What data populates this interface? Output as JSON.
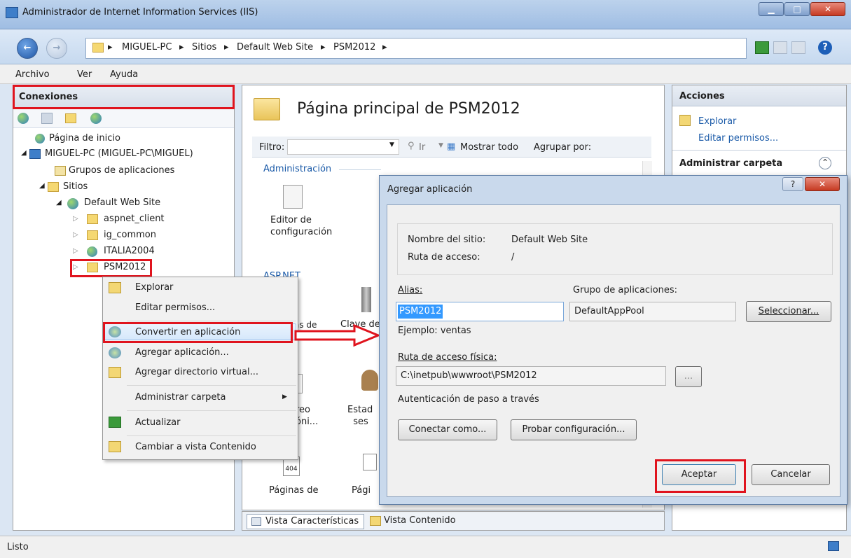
{
  "window": {
    "title": "Administrador de Internet Information Services (IIS)"
  },
  "breadcrumb": [
    "MIGUEL-PC",
    "Sitios",
    "Default Web Site",
    "PSM2012"
  ],
  "menu": [
    "Archivo",
    "Ver",
    "Ayuda"
  ],
  "connections": {
    "title": "Conexiones",
    "tree": [
      "Página de inicio",
      "MIGUEL-PC (MIGUEL-PC\\MIGUEL)",
      "Grupos de aplicaciones",
      "Sitios",
      "Default Web Site",
      "aspnet_client",
      "ig_common",
      "ITALIA2004",
      "PSM2012"
    ]
  },
  "context_menu": [
    "Explorar",
    "Editar permisos...",
    "Convertir en aplicación",
    "Agregar aplicación...",
    "Agregar directorio virtual...",
    "Administrar carpeta",
    "Actualizar",
    "Cambiar a vista Contenido"
  ],
  "center": {
    "title": "Página principal de PSM2012",
    "filter_label": "Filtro:",
    "go_label": "Ir",
    "show_all": "Mostrar todo",
    "group_by": "Agrupar por:",
    "section_admin": "Administración",
    "section_aspnet": "ASP.NET",
    "features": {
      "config_editor": "Editor de configuración",
      "conn_strings_partial": "...as de ...xión",
      "machine_key_partial": "Clave de",
      "smtp_partial": "...reo ...óni...",
      "session_partial": "Estad... ses...",
      "error_pages": "Páginas de",
      "pages_partial": "Pági..."
    },
    "tab_features": "Vista Características",
    "tab_content": "Vista Contenido"
  },
  "actions": {
    "title": "Acciones",
    "explore": "Explorar",
    "edit_permissions": "Editar permisos...",
    "manage_folder": "Administrar carpeta"
  },
  "dialog": {
    "title": "Agregar aplicación",
    "site_name_label": "Nombre del sitio:",
    "site_name_value": "Default Web Site",
    "path_label": "Ruta de acceso:",
    "path_value": "/",
    "alias_label": "Alias:",
    "alias_value": "PSM2012",
    "pool_label": "Grupo de aplicaciones:",
    "pool_value": "DefaultAppPool",
    "select_button": "Seleccionar...",
    "example": "Ejemplo: ventas",
    "physical_path_label": "Ruta de acceso física:",
    "physical_path_value": "C:\\inetpub\\wwwroot\\PSM2012",
    "browse_button": "...",
    "auth_label": "Autenticación de paso a través",
    "connect_as": "Conectar como...",
    "test_config": "Probar configuración...",
    "ok": "Aceptar",
    "cancel": "Cancelar"
  },
  "status": {
    "text": "Listo"
  },
  "colors": {
    "highlight": "#e0141e",
    "link": "#1a5aa8",
    "selection": "#3399ff"
  }
}
